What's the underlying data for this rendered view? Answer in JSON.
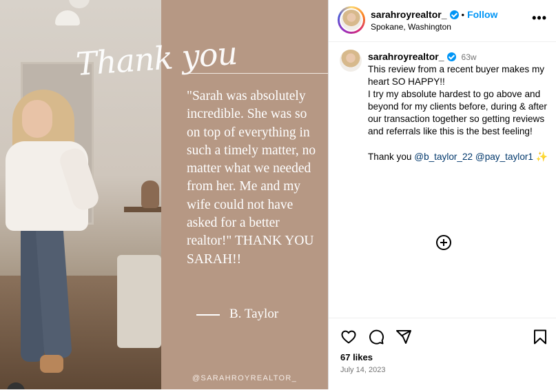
{
  "post_image": {
    "script_title": "Thank you",
    "quote": "\"Sarah was absolutely incredible. She was so on top of everything in such a timely matter, no matter what we needed from her. Me and my wife could not have asked for a better realtor!\" THANK YOU SARAH!!",
    "author": "B. Taylor",
    "watermark": "@SARAHROYREALTOR_"
  },
  "header": {
    "username": "sarahroyrealtor_",
    "separator": "•",
    "follow_label": "Follow",
    "location": "Spokane, Washington",
    "more_label": "•••"
  },
  "caption": {
    "username": "sarahroyrealtor_",
    "age": "63w",
    "line1": "This review from a recent buyer makes my heart SO HAPPY!!",
    "line2": "I try my absolute hardest to go above and beyond for my clients before, during & after our transaction together so getting reviews and referrals like this is the best feeling!",
    "thanks_prefix": "Thank you",
    "mention1": "@b_taylor_22",
    "mention2": "@pay_taylor1",
    "emoji": "✨"
  },
  "footer": {
    "likes": "67 likes",
    "date": "July 14, 2023"
  },
  "icons": {
    "like": "heart-icon",
    "comment": "comment-icon",
    "share": "share-icon",
    "save": "bookmark-icon",
    "load_more": "plus-circle-icon"
  },
  "colors": {
    "follow_blue": "#0095f6",
    "review_panel": "#b69884",
    "mention": "#00376b"
  }
}
